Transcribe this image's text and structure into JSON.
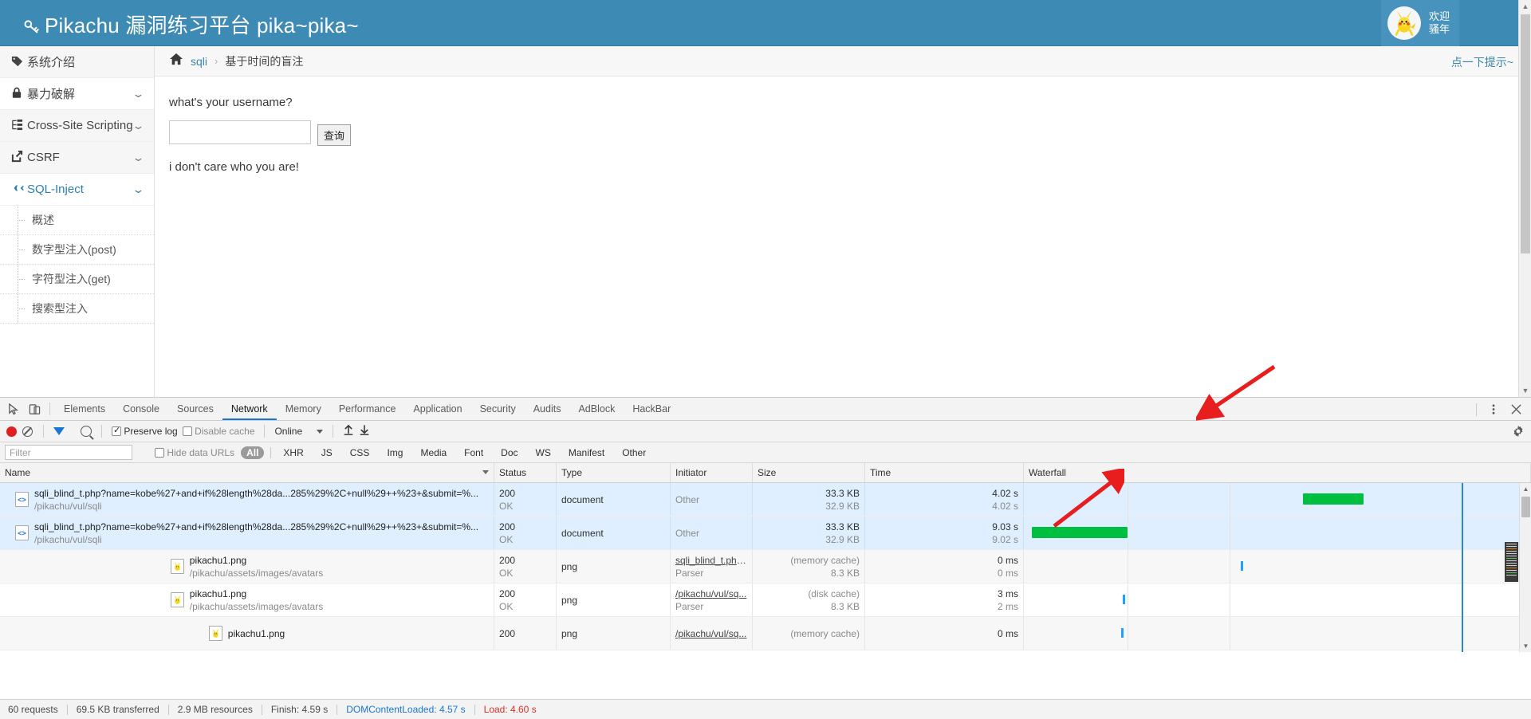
{
  "site": {
    "title": "Pikachu 漏洞练习平台 pika~pika~",
    "key_icon": "key-icon",
    "welcome_line1": "欢迎",
    "welcome_line2": "骚年",
    "avatar_icon": "pikachu-avatar"
  },
  "sidebar": {
    "items": [
      {
        "label": "系统介绍",
        "icon": "tag-icon",
        "chevron": "",
        "active": false,
        "has_chevron": false
      },
      {
        "label": "暴力破解",
        "icon": "lock-icon",
        "chevron": "⌄",
        "active": false,
        "has_chevron": true
      },
      {
        "label": "Cross-Site Scripting",
        "icon": "sitemap-icon",
        "chevron": "⌄",
        "active": false,
        "has_chevron": true
      },
      {
        "label": "CSRF",
        "icon": "share-icon",
        "chevron": "⌄",
        "active": false,
        "has_chevron": true
      },
      {
        "label": "SQL-Inject",
        "icon": "plane-icon",
        "chevron": "⌄",
        "active": true,
        "has_chevron": true
      }
    ],
    "sub_items": [
      {
        "label": "概述"
      },
      {
        "label": "数字型注入(post)"
      },
      {
        "label": "字符型注入(get)"
      },
      {
        "label": "搜索型注入"
      }
    ]
  },
  "breadcrumb": {
    "home_icon": "home-icon",
    "parent": "sqli",
    "separator": "›",
    "current": "基于时间的盲注",
    "hint_link": "点一下提示~"
  },
  "form": {
    "question": "what's your username?",
    "input_value": "",
    "input_placeholder": "",
    "submit_label": "查询",
    "result": "i don't care who you are!"
  },
  "devtools": {
    "tabs": [
      {
        "label": "Elements",
        "selected": false
      },
      {
        "label": "Console",
        "selected": false
      },
      {
        "label": "Sources",
        "selected": false
      },
      {
        "label": "Network",
        "selected": true
      },
      {
        "label": "Memory",
        "selected": false
      },
      {
        "label": "Performance",
        "selected": false
      },
      {
        "label": "Application",
        "selected": false
      },
      {
        "label": "Security",
        "selected": false
      },
      {
        "label": "Audits",
        "selected": false
      },
      {
        "label": "AdBlock",
        "selected": false
      },
      {
        "label": "HackBar",
        "selected": false
      }
    ],
    "toolbar": {
      "record_icon": "record-icon",
      "clear_icon": "clear-icon",
      "filter_icon": "funnel-icon",
      "search_icon": "search-icon",
      "preserve_log_label": "Preserve log",
      "preserve_log_checked": true,
      "disable_cache_label": "Disable cache",
      "disable_cache_checked": false,
      "throttling_value": "Online",
      "import_icon": "upload-icon",
      "export_icon": "download-icon",
      "settings_icon": "gear-icon",
      "more_icon": "kebab-menu-icon",
      "close_icon": "close-icon",
      "inspect_icon": "inspect-element-icon",
      "device_icon": "device-toolbar-icon"
    },
    "filterbar": {
      "filter_placeholder": "Filter",
      "filter_value": "",
      "hide_data_urls_label": "Hide data URLs",
      "hide_data_urls_checked": false,
      "types": [
        {
          "label": "All",
          "active": true
        },
        {
          "label": "XHR",
          "active": false
        },
        {
          "label": "JS",
          "active": false
        },
        {
          "label": "CSS",
          "active": false
        },
        {
          "label": "Img",
          "active": false
        },
        {
          "label": "Media",
          "active": false
        },
        {
          "label": "Font",
          "active": false
        },
        {
          "label": "Doc",
          "active": false
        },
        {
          "label": "WS",
          "active": false
        },
        {
          "label": "Manifest",
          "active": false
        },
        {
          "label": "Other",
          "active": false
        }
      ]
    },
    "columns": {
      "name": "Name",
      "status": "Status",
      "type": "Type",
      "initiator": "Initiator",
      "size": "Size",
      "time": "Time",
      "waterfall": "Waterfall"
    },
    "rows": [
      {
        "name": "sqli_blind_t.php?name=kobe%27+and+if%28length%28da...285%29%2C+null%29++%23+&submit=%...",
        "path": "/pikachu/vul/sqli",
        "icon": "document-file-icon",
        "status_code": "200",
        "status_text": "OK",
        "type": "document",
        "initiator": "Other",
        "initiator_sub": "",
        "size_main": "33.3 KB",
        "size_sub": "32.9 KB",
        "time_main": "4.02 s",
        "time_sub": "4.02 s",
        "selected": true
      },
      {
        "name": "sqli_blind_t.php?name=kobe%27+and+if%28length%28da...285%29%2C+null%29++%23+&submit=%...",
        "path": "/pikachu/vul/sqli",
        "icon": "document-file-icon",
        "status_code": "200",
        "status_text": "OK",
        "type": "document",
        "initiator": "Other",
        "initiator_sub": "",
        "size_main": "33.3 KB",
        "size_sub": "32.9 KB",
        "time_main": "9.03 s",
        "time_sub": "9.02 s",
        "selected": true
      },
      {
        "name": "pikachu1.png",
        "path": "/pikachu/assets/images/avatars",
        "icon": "image-file-icon",
        "status_code": "200",
        "status_text": "OK",
        "type": "png",
        "initiator": "sqli_blind_t.php...",
        "initiator_sub": "Parser",
        "size_main": "(memory cache)",
        "size_sub": "8.3 KB",
        "time_main": "0 ms",
        "time_sub": "0 ms",
        "selected": false
      },
      {
        "name": "pikachu1.png",
        "path": "/pikachu/assets/images/avatars",
        "icon": "image-file-icon",
        "status_code": "200",
        "status_text": "OK",
        "type": "png",
        "initiator": "/pikachu/vul/sq...",
        "initiator_sub": "Parser",
        "size_main": "(disk cache)",
        "size_sub": "8.3 KB",
        "time_main": "3 ms",
        "time_sub": "2 ms",
        "selected": false
      },
      {
        "name": "pikachu1.png",
        "path": "",
        "icon": "image-file-icon",
        "status_code": "200",
        "status_text": "",
        "type": "png",
        "initiator": "/pikachu/vul/sq...",
        "initiator_sub": "",
        "size_main": "(memory cache)",
        "size_sub": "",
        "time_main": "0 ms",
        "time_sub": "",
        "selected": false
      }
    ],
    "status_bar": {
      "requests": "60 requests",
      "transferred": "69.5 KB transferred",
      "resources": "2.9 MB resources",
      "finish": "Finish: 4.59 s",
      "dom_content_loaded": "DOMContentLoaded: 4.57 s",
      "load": "Load: 4.60 s"
    }
  },
  "colors": {
    "brand_blue": "#3d8ab4",
    "link_blue": "#3b86ad",
    "devtools_accent": "#1a76d2",
    "waterfall_green": "#00bf40",
    "annotation_red": "#e81d1d",
    "load_red": "#d93025"
  }
}
